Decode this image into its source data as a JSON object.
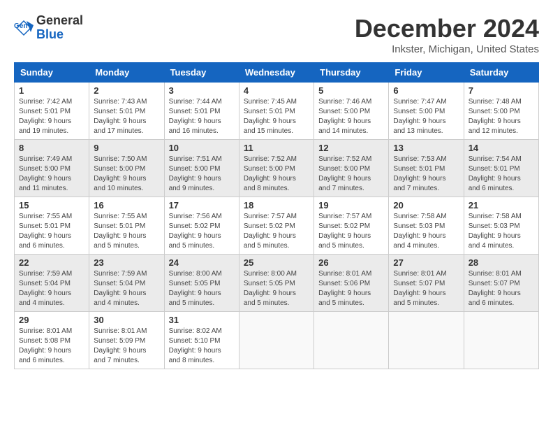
{
  "header": {
    "logo_line1": "General",
    "logo_line2": "Blue",
    "month_title": "December 2024",
    "location": "Inkster, Michigan, United States"
  },
  "days_of_week": [
    "Sunday",
    "Monday",
    "Tuesday",
    "Wednesday",
    "Thursday",
    "Friday",
    "Saturday"
  ],
  "weeks": [
    [
      {
        "day": "1",
        "sunrise": "7:42 AM",
        "sunset": "5:01 PM",
        "daylight": "9 hours and 19 minutes."
      },
      {
        "day": "2",
        "sunrise": "7:43 AM",
        "sunset": "5:01 PM",
        "daylight": "9 hours and 17 minutes."
      },
      {
        "day": "3",
        "sunrise": "7:44 AM",
        "sunset": "5:01 PM",
        "daylight": "9 hours and 16 minutes."
      },
      {
        "day": "4",
        "sunrise": "7:45 AM",
        "sunset": "5:01 PM",
        "daylight": "9 hours and 15 minutes."
      },
      {
        "day": "5",
        "sunrise": "7:46 AM",
        "sunset": "5:00 PM",
        "daylight": "9 hours and 14 minutes."
      },
      {
        "day": "6",
        "sunrise": "7:47 AM",
        "sunset": "5:00 PM",
        "daylight": "9 hours and 13 minutes."
      },
      {
        "day": "7",
        "sunrise": "7:48 AM",
        "sunset": "5:00 PM",
        "daylight": "9 hours and 12 minutes."
      }
    ],
    [
      {
        "day": "8",
        "sunrise": "7:49 AM",
        "sunset": "5:00 PM",
        "daylight": "9 hours and 11 minutes."
      },
      {
        "day": "9",
        "sunrise": "7:50 AM",
        "sunset": "5:00 PM",
        "daylight": "9 hours and 10 minutes."
      },
      {
        "day": "10",
        "sunrise": "7:51 AM",
        "sunset": "5:00 PM",
        "daylight": "9 hours and 9 minutes."
      },
      {
        "day": "11",
        "sunrise": "7:52 AM",
        "sunset": "5:00 PM",
        "daylight": "9 hours and 8 minutes."
      },
      {
        "day": "12",
        "sunrise": "7:52 AM",
        "sunset": "5:00 PM",
        "daylight": "9 hours and 7 minutes."
      },
      {
        "day": "13",
        "sunrise": "7:53 AM",
        "sunset": "5:01 PM",
        "daylight": "9 hours and 7 minutes."
      },
      {
        "day": "14",
        "sunrise": "7:54 AM",
        "sunset": "5:01 PM",
        "daylight": "9 hours and 6 minutes."
      }
    ],
    [
      {
        "day": "15",
        "sunrise": "7:55 AM",
        "sunset": "5:01 PM",
        "daylight": "9 hours and 6 minutes."
      },
      {
        "day": "16",
        "sunrise": "7:55 AM",
        "sunset": "5:01 PM",
        "daylight": "9 hours and 5 minutes."
      },
      {
        "day": "17",
        "sunrise": "7:56 AM",
        "sunset": "5:02 PM",
        "daylight": "9 hours and 5 minutes."
      },
      {
        "day": "18",
        "sunrise": "7:57 AM",
        "sunset": "5:02 PM",
        "daylight": "9 hours and 5 minutes."
      },
      {
        "day": "19",
        "sunrise": "7:57 AM",
        "sunset": "5:02 PM",
        "daylight": "9 hours and 5 minutes."
      },
      {
        "day": "20",
        "sunrise": "7:58 AM",
        "sunset": "5:03 PM",
        "daylight": "9 hours and 4 minutes."
      },
      {
        "day": "21",
        "sunrise": "7:58 AM",
        "sunset": "5:03 PM",
        "daylight": "9 hours and 4 minutes."
      }
    ],
    [
      {
        "day": "22",
        "sunrise": "7:59 AM",
        "sunset": "5:04 PM",
        "daylight": "9 hours and 4 minutes."
      },
      {
        "day": "23",
        "sunrise": "7:59 AM",
        "sunset": "5:04 PM",
        "daylight": "9 hours and 4 minutes."
      },
      {
        "day": "24",
        "sunrise": "8:00 AM",
        "sunset": "5:05 PM",
        "daylight": "9 hours and 5 minutes."
      },
      {
        "day": "25",
        "sunrise": "8:00 AM",
        "sunset": "5:05 PM",
        "daylight": "9 hours and 5 minutes."
      },
      {
        "day": "26",
        "sunrise": "8:01 AM",
        "sunset": "5:06 PM",
        "daylight": "9 hours and 5 minutes."
      },
      {
        "day": "27",
        "sunrise": "8:01 AM",
        "sunset": "5:07 PM",
        "daylight": "9 hours and 5 minutes."
      },
      {
        "day": "28",
        "sunrise": "8:01 AM",
        "sunset": "5:07 PM",
        "daylight": "9 hours and 6 minutes."
      }
    ],
    [
      {
        "day": "29",
        "sunrise": "8:01 AM",
        "sunset": "5:08 PM",
        "daylight": "9 hours and 6 minutes."
      },
      {
        "day": "30",
        "sunrise": "8:01 AM",
        "sunset": "5:09 PM",
        "daylight": "9 hours and 7 minutes."
      },
      {
        "day": "31",
        "sunrise": "8:02 AM",
        "sunset": "5:10 PM",
        "daylight": "9 hours and 8 minutes."
      },
      null,
      null,
      null,
      null
    ]
  ]
}
